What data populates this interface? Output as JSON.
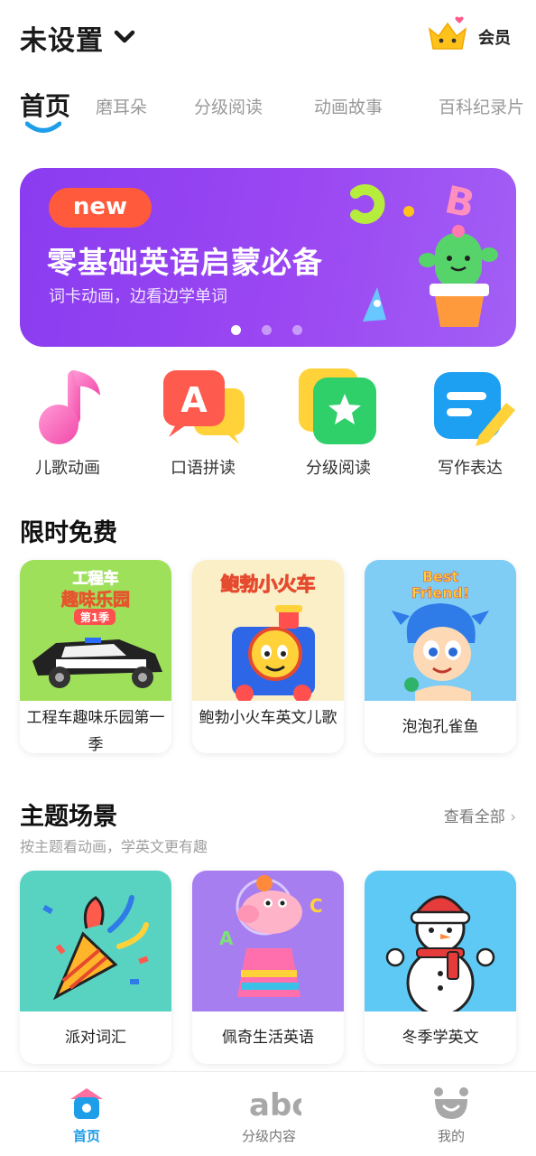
{
  "header": {
    "profile_name": "未设置",
    "vip_label": "会员"
  },
  "tabs": [
    {
      "label": "首页",
      "active": true
    },
    {
      "label": "磨耳朵"
    },
    {
      "label": "分级阅读"
    },
    {
      "label": "动画故事"
    },
    {
      "label": "百科纪录片"
    }
  ],
  "banner": {
    "badge": "new",
    "title": "零基础英语启蒙必备",
    "subtitle": "词卡动画，边看边学单词",
    "slide_count": 3,
    "active_slide": 1,
    "color": "#9b47f2"
  },
  "quick_entries": [
    {
      "label": "儿歌动画",
      "icon": "music-note-icon"
    },
    {
      "label": "口语拼读",
      "icon": "speech-a-icon"
    },
    {
      "label": "分级阅读",
      "icon": "star-book-icon"
    },
    {
      "label": "写作表达",
      "icon": "pencil-note-icon"
    }
  ],
  "free_section": {
    "title": "限时免费",
    "items": [
      {
        "title": "工程车趣味乐园第一季",
        "thumb_text": "工程车趣味乐园 第1季"
      },
      {
        "title": "鲍勃小火车英文儿歌",
        "thumb_text": "鲍勃小火车"
      },
      {
        "title": "泡泡孔雀鱼",
        "thumb_text": "Best Friend!"
      }
    ]
  },
  "theme_section": {
    "title": "主题场景",
    "subtitle": "按主题看动画，学英文更有趣",
    "see_all": "查看全部",
    "items": [
      {
        "title": "派对词汇"
      },
      {
        "title": "佩奇生活英语"
      },
      {
        "title": "冬季学英文"
      }
    ]
  },
  "bottom_nav": [
    {
      "label": "首页",
      "icon": "home-icon",
      "active": true
    },
    {
      "label": "分级内容",
      "icon": "abc-icon"
    },
    {
      "label": "我的",
      "icon": "face-icon"
    }
  ],
  "colors": {
    "accent": "#1e9de8",
    "banner": "#9b47f2",
    "badge": "#ff5a3c"
  }
}
